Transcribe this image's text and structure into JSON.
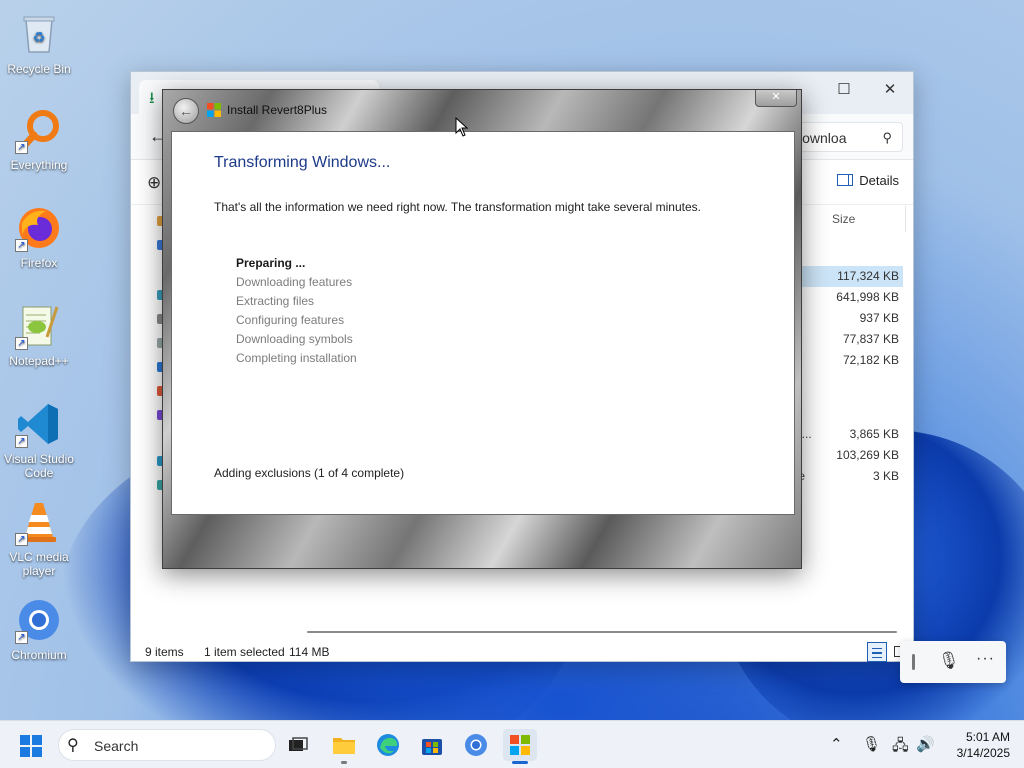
{
  "desktop": {
    "icons": [
      {
        "label": "Recycle Bin",
        "icon": "recycle-bin-icon"
      },
      {
        "label": "Everything",
        "icon": "everything-search-icon"
      },
      {
        "label": "Firefox",
        "icon": "firefox-icon"
      },
      {
        "label": "Notepad++",
        "icon": "notepadpp-icon"
      },
      {
        "label": "Visual Studio Code",
        "icon": "vscode-icon"
      },
      {
        "label": "VLC media player",
        "icon": "vlc-icon"
      },
      {
        "label": "Chromium",
        "icon": "chromium-icon"
      }
    ]
  },
  "explorer": {
    "search_placeholder": "Downloa",
    "details_label": "Details",
    "column_size": "Size",
    "rows": [
      {
        "type": "",
        "size": "117,324 KB",
        "selected": true
      },
      {
        "type": "e",
        "size": "641,998 KB",
        "selected": false
      },
      {
        "type": "",
        "size": "937 KB",
        "selected": false
      },
      {
        "type": "e",
        "size": "77,837 KB",
        "selected": false
      },
      {
        "type": "e",
        "size": "72,182 KB",
        "selected": false
      },
      {
        "type": "o...",
        "size": "3,865 KB",
        "selected": false
      },
      {
        "type": "",
        "size": "103,269 KB",
        "selected": false
      },
      {
        "type": "te",
        "size": "3 KB",
        "selected": false
      }
    ],
    "status": {
      "item_count": "9 items",
      "selection": "1 item selected",
      "selection_size": "114 MB"
    }
  },
  "installer": {
    "title": "Install Revert8Plus",
    "close_glyph": "✕",
    "heading": "Transforming Windows...",
    "info": "That's all the information we need right now. The transformation might take several minutes.",
    "steps": [
      {
        "label": "Preparing ...",
        "active": true
      },
      {
        "label": "Downloading features",
        "active": false
      },
      {
        "label": "Extracting files",
        "active": false
      },
      {
        "label": "Configuring features",
        "active": false
      },
      {
        "label": "Downloading symbols",
        "active": false
      },
      {
        "label": "Completing installation",
        "active": false
      }
    ],
    "status": "Adding exclusions (1 of 4 complete)"
  },
  "taskbar": {
    "search_placeholder": "Search",
    "apps": [
      "task-view-icon",
      "file-explorer-icon",
      "edge-icon",
      "store-icon",
      "chromium-icon",
      "revert8plus-icon"
    ],
    "clock": {
      "time": "5:01 AM",
      "date": "3/14/2025"
    }
  },
  "colors": {
    "accent": "#1a67d2",
    "heading": "#1d3a8a",
    "selected_row": "#cce4f7"
  }
}
